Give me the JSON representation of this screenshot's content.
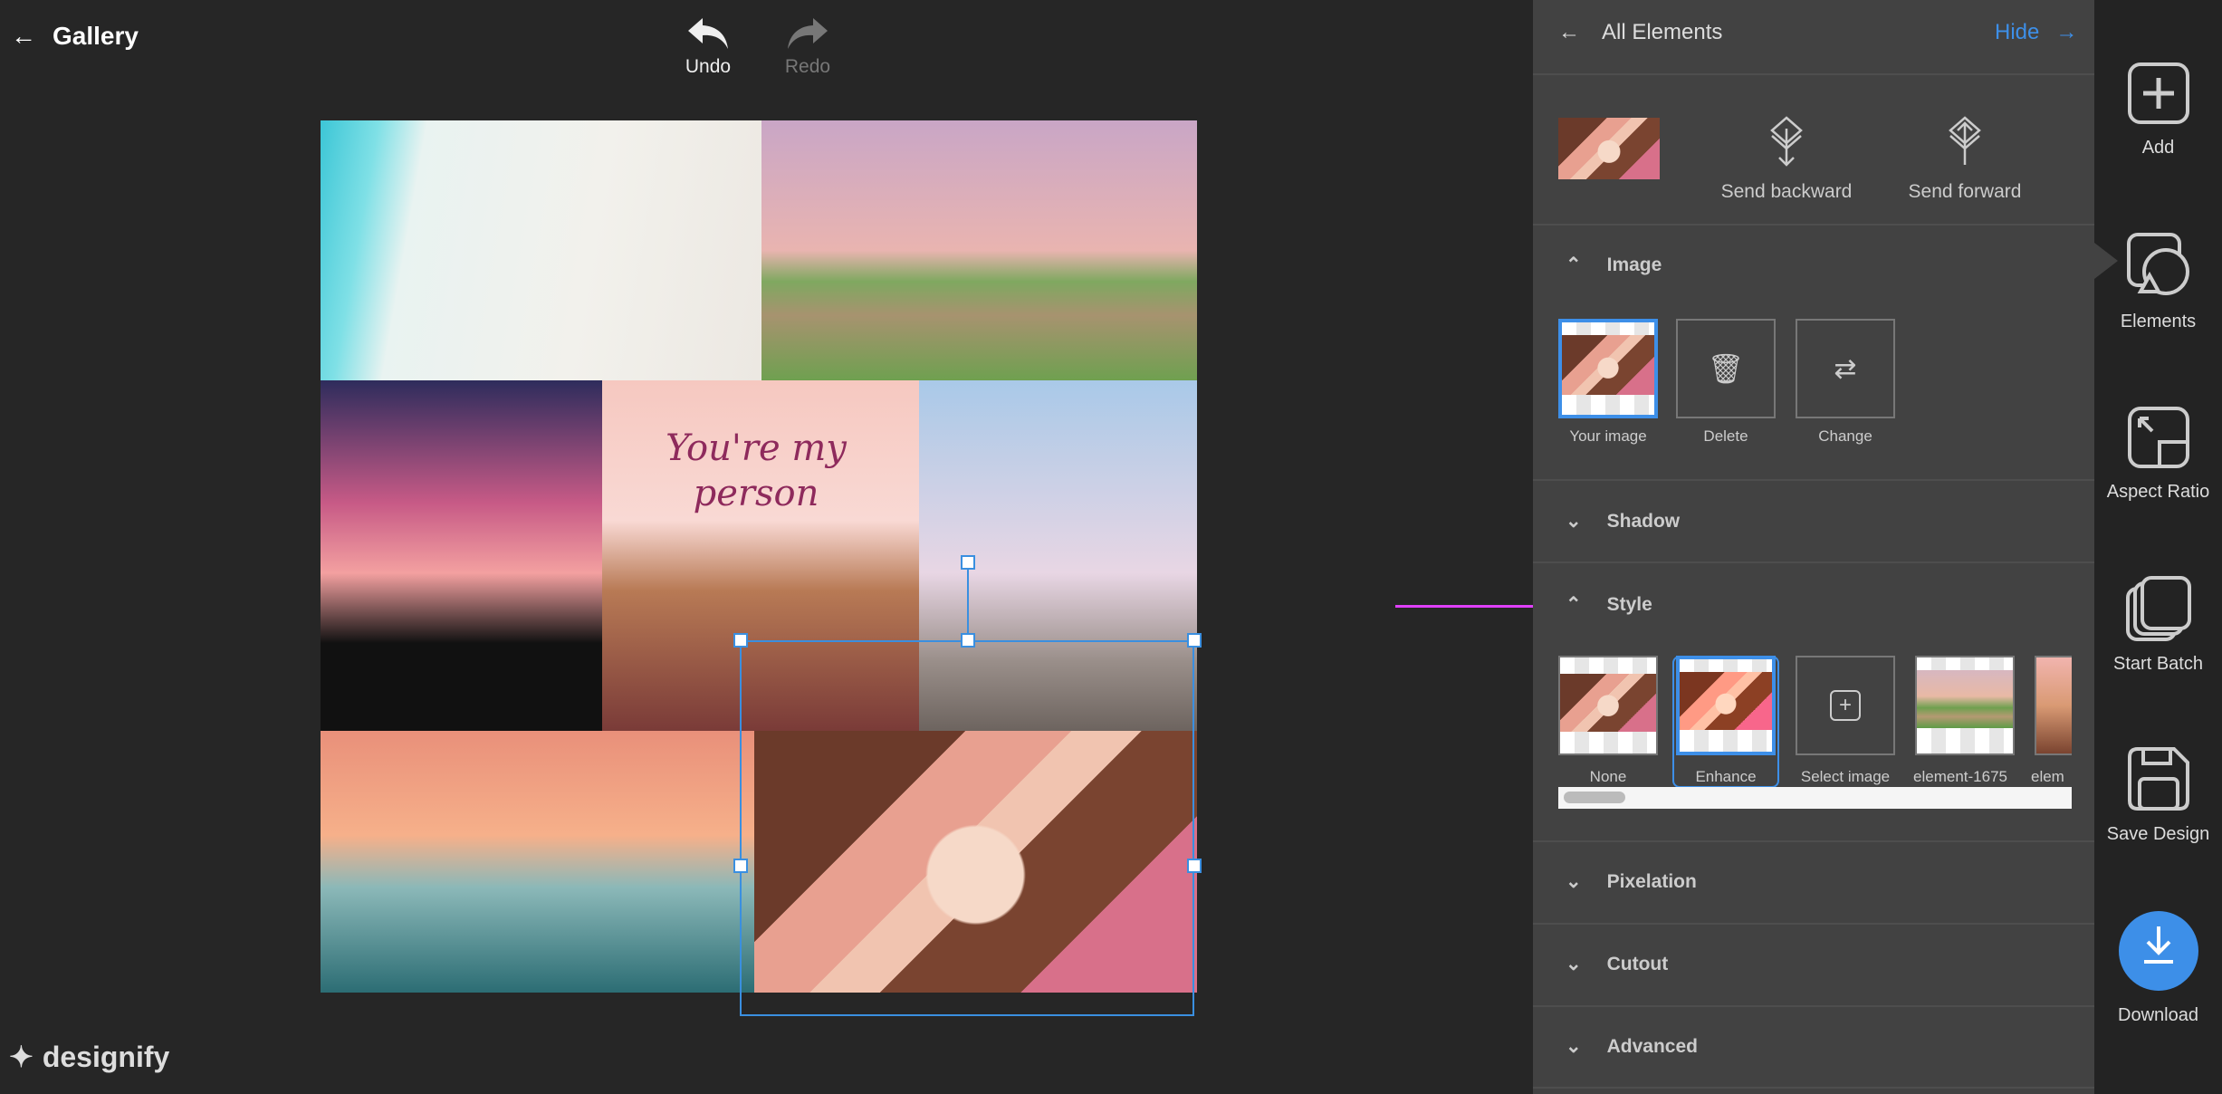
{
  "topbar": {
    "back_label": "Gallery",
    "undo": "Undo",
    "redo": "Redo"
  },
  "canvas": {
    "overlay_text": "You're my person"
  },
  "panel": {
    "title": "All Elements",
    "hide": "Hide",
    "send_backward": "Send backward",
    "send_forward": "Send forward",
    "sections": {
      "image": "Image",
      "shadow": "Shadow",
      "style": "Style",
      "pixelation": "Pixelation",
      "cutout": "Cutout",
      "advanced": "Advanced"
    },
    "image_items": [
      "Your image",
      "Delete",
      "Change"
    ],
    "style_items": [
      "None",
      "Enhance",
      "Select image",
      "element-1675",
      "elem"
    ],
    "selected_style": "Enhance"
  },
  "sidebar": {
    "items": [
      "Add",
      "Elements",
      "Aspect Ratio",
      "Start Batch",
      "Save Design",
      "Download"
    ],
    "active": "Elements"
  },
  "brand": {
    "logo": "designify"
  },
  "colors": {
    "accent": "#3d8fe8",
    "annotation_arrow": "#e040fb",
    "panel": "#424242"
  }
}
